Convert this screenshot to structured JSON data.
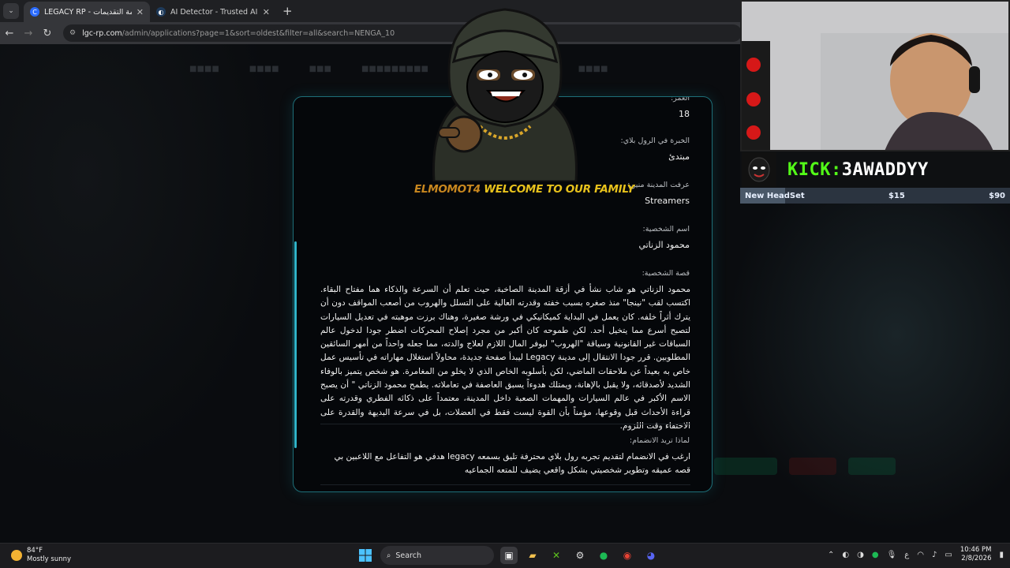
{
  "browser": {
    "tabs": [
      {
        "title": "LEGACY RP - قائمة التقديمات",
        "active": true
      },
      {
        "title": "AI Detector - Trusted AI Checker",
        "active": false
      }
    ],
    "url_host": "lgc-rp.com",
    "url_path": "/admin/applications?page=1&sort=oldest&filter=all&search=NENGA_10"
  },
  "application": {
    "age": {
      "label": "العمر:",
      "value": "18"
    },
    "experience": {
      "label": "الخبرة في الرول بلاي:",
      "value": "مبتدئ"
    },
    "how_known": {
      "label": "عرفت المدينة منين:",
      "value": "Streamers"
    },
    "character_name": {
      "label": "اسم الشخصية:",
      "value": "محمود الزناتي"
    },
    "story": {
      "label": "قصة الشخصية:",
      "text": "محمود الزناتي هو شاب نشأ في أزقة المدينة الصاخبة، حيث تعلم أن السرعة والذكاء هما مفتاح البقاء. اكتسب لقب \"نينجا\" منذ صغره بسبب خفته وقدرته العالية على التسلل والهروب من أصعب المواقف دون أن يترك أثراً خلفه. كان يعمل في البداية كميكانيكي في ورشة صغيرة، وهناك برزت موهبته في تعديل السيارات لتصبح أسرع مما يتخيل أحد. لكن طموحه كان أكبر من مجرد إصلاح المحركات اضطر جودا لدخول عالم السباقات غير القانونية وسياقة \"الهروب\" ليوفر المال اللازم لعلاج والدته، مما جعله واحداً من أمهر السائقين المطلوبين. قرر جودا الانتقال إلى مدينة Legacy ليبدأ صفحة جديدة، محاولاً استغلال مهاراته في تأسيس عمل خاص به بعيداً عن ملاحقات الماضي، لكن بأسلوبه الخاص الذي لا يخلو من المغامرة. هو شخص يتميز بالوفاء الشديد لأصدقائه، ولا يقبل بالإهانة، ويمتلك هدوءاً يسبق العاصفة في تعاملاته. يطمح محمود الزناتي \" أن يصبح الاسم الأكبر في عالم السيارات والمهمات الصعبة داخل المدينة، معتمداً على ذكائه الفطري وقدرته على قراءة الأحداث قبل وقوعها، مؤمناً بأن القوة ليست فقط في العضلات، بل في سرعة البديهة والقدرة على الاختفاء وقت اللزوم."
    },
    "reason": {
      "label": "لماذا تريد الانضمام:",
      "text": "ارغب في الانضمام لتقديم تجربه رول بلاي محترفة تليق بسمعه legacy هدفي هو التفاعل مع اللاعبين بي قصه عميقه وتطوير شخصيتي بشكل واقعي يضيف للمتعه الجماعيه"
    }
  },
  "overlay": {
    "welcome_name": "ELMOMOT4",
    "welcome_text": "WELCOME TO OUR FAMILY",
    "kick_prefix": "KICK:",
    "kick_channel": "3AWADDYY",
    "goal_title": "New HeadSet",
    "goal_current": "$15",
    "goal_target": "$90",
    "goal_progress": 0.1667
  },
  "taskbar": {
    "temperature": "84°F",
    "weather": "Mostly sunny",
    "search_placeholder": "Search",
    "lang": "ع",
    "time": "10:46 PM",
    "date": "2/8/2026"
  },
  "colors": {
    "accent_border": "#1e6e78",
    "kick_green": "#53fc18",
    "scroll": "#2fb4c8"
  }
}
